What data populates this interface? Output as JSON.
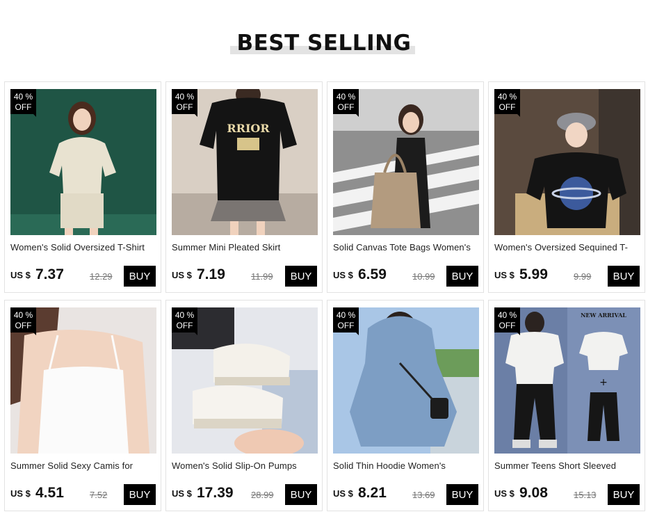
{
  "section": {
    "title": "BEST SELLING"
  },
  "badge": {
    "line1": "40 %",
    "line2": "OFF"
  },
  "currency": "US $",
  "buy_label": "BUY",
  "products": [
    {
      "name": "Women's Solid Oversized T-Shirt",
      "price": "7.37",
      "old_price": "12.29",
      "image": "beige-oversized-tshirt-set"
    },
    {
      "name": "Summer Mini Pleated Skirt",
      "price": "7.19",
      "old_price": "11.99",
      "image": "black-tee-pleated-skirt"
    },
    {
      "name": "Solid Canvas Tote Bags Women's",
      "price": "6.59",
      "old_price": "10.99",
      "image": "khaki-canvas-tote"
    },
    {
      "name": "Women's Oversized Sequined T-",
      "price": "5.99",
      "old_price": "9.99",
      "image": "black-sequin-planet-tee"
    },
    {
      "name": "Summer Solid Sexy Camis for",
      "price": "4.51",
      "old_price": "7.52",
      "image": "white-cami-top"
    },
    {
      "name": "Women's Solid Slip-On Pumps",
      "price": "17.39",
      "old_price": "28.99",
      "image": "white-slip-on-sneakers"
    },
    {
      "name": "Solid Thin Hoodie Women's",
      "price": "8.21",
      "old_price": "13.69",
      "image": "blue-hoodie"
    },
    {
      "name": "Summer Teens Short Sleeved",
      "price": "9.08",
      "old_price": "15.13",
      "image": "tee-and-jogger-set"
    }
  ],
  "overlay_text": {
    "new_arrival": "NEW ARRIVAL"
  },
  "colors": {
    "buy_button": "#000000",
    "badge": "#000000",
    "title_underline": "#e3e3e3"
  }
}
